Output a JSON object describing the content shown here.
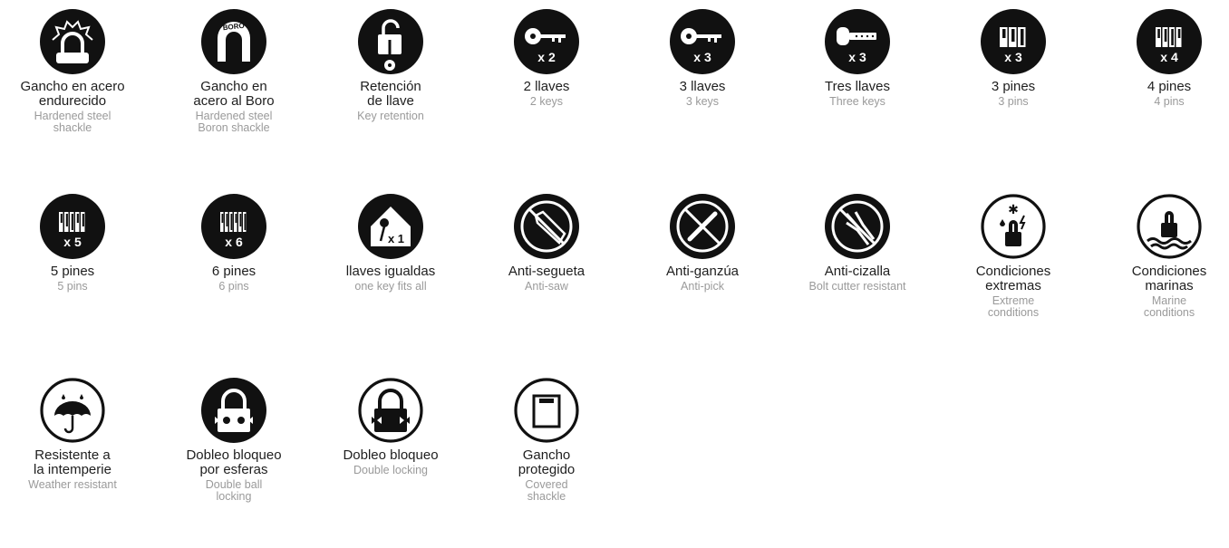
{
  "features": [
    {
      "icon": "hardened-shackle-icon",
      "es": [
        "Gancho en acero",
        "endurecido"
      ],
      "en": [
        "Hardened steel",
        "shackle"
      ]
    },
    {
      "icon": "boron-shackle-icon",
      "es": [
        "Gancho en",
        "acero al Boro"
      ],
      "en": [
        "Hardened steel",
        "Boron shackle"
      ],
      "badge": "BORO"
    },
    {
      "icon": "key-retention-icon",
      "es": [
        "Retención",
        "de llave"
      ],
      "en": [
        "Key retention"
      ]
    },
    {
      "icon": "two-keys-icon",
      "es": [
        "2 llaves"
      ],
      "en": [
        "2 keys"
      ],
      "badge": "x 2"
    },
    {
      "icon": "three-keys-icon",
      "es": [
        "3 llaves"
      ],
      "en": [
        "3 keys"
      ],
      "badge": "x 3"
    },
    {
      "icon": "three-dimple-keys-icon",
      "es": [
        "Tres llaves"
      ],
      "en": [
        "Three keys"
      ],
      "badge": "x 3"
    },
    {
      "icon": "three-pins-icon",
      "es": [
        "3 pines"
      ],
      "en": [
        "3 pins"
      ],
      "badge": "x 3"
    },
    {
      "icon": "four-pins-icon",
      "es": [
        "4 pines"
      ],
      "en": [
        "4 pins"
      ],
      "badge": "x 4"
    },
    {
      "icon": "five-pins-icon",
      "es": [
        "5 pines"
      ],
      "en": [
        "5 pins"
      ],
      "badge": "x 5"
    },
    {
      "icon": "six-pins-icon",
      "es": [
        "6 pines"
      ],
      "en": [
        "6 pins"
      ],
      "badge": "x 6"
    },
    {
      "icon": "keyed-alike-icon",
      "es": [
        "llaves igualdas"
      ],
      "en": [
        "one key fits all"
      ],
      "badge": "x 1"
    },
    {
      "icon": "anti-saw-icon",
      "es": [
        "Anti-segueta"
      ],
      "en": [
        "Anti-saw"
      ]
    },
    {
      "icon": "anti-pick-icon",
      "es": [
        "Anti-ganzúa"
      ],
      "en": [
        "Anti-pick"
      ]
    },
    {
      "icon": "anti-bolt-cutter-icon",
      "es": [
        "Anti-cizalla"
      ],
      "en": [
        "Bolt cutter resistant"
      ]
    },
    {
      "icon": "extreme-conditions-icon",
      "es": [
        "Condiciones",
        "extremas"
      ],
      "en": [
        "Extreme",
        "conditions"
      ]
    },
    {
      "icon": "marine-conditions-icon",
      "es": [
        "Condiciones",
        "marinas"
      ],
      "en": [
        "Marine",
        "conditions"
      ]
    },
    {
      "icon": "weather-resistant-icon",
      "es": [
        "Resistente a",
        "la intemperie"
      ],
      "en": [
        "Weather resistant"
      ]
    },
    {
      "icon": "double-ball-locking-icon",
      "es": [
        "Dobleo bloqueo",
        "por esferas"
      ],
      "en": [
        "Double ball",
        "locking"
      ]
    },
    {
      "icon": "double-locking-icon",
      "es": [
        "Dobleo bloqueo"
      ],
      "en": [
        "Double locking"
      ]
    },
    {
      "icon": "covered-shackle-icon",
      "es": [
        "Gancho",
        "protegido"
      ],
      "en": [
        "Covered",
        "shackle"
      ]
    }
  ]
}
